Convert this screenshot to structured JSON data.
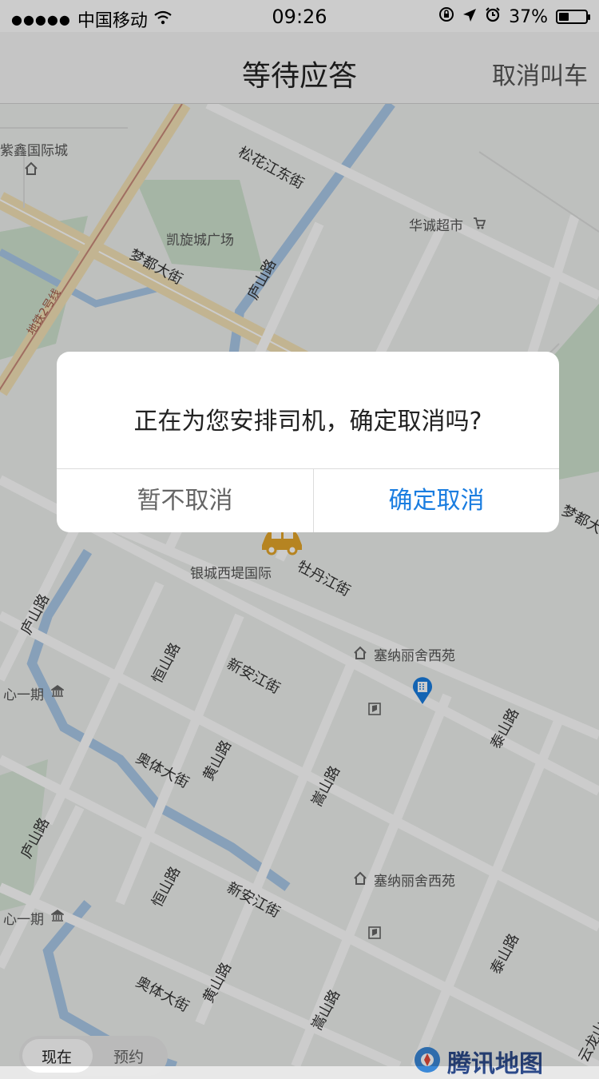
{
  "status_bar": {
    "carrier": "中国移动",
    "time": "09:26",
    "battery": "37%",
    "battery_level": 0.37
  },
  "nav": {
    "title": "等待应答",
    "cancel_label": "取消叫车"
  },
  "map": {
    "labels": {
      "zixin": "紫鑫国际城",
      "kaixuan": "凯旋城广场",
      "huacheng": "华诚超市",
      "yincheng": "银城西堤国际",
      "sainali_1": "塞纳丽舍西苑",
      "sainali_2": "塞纳丽舍西苑",
      "xinyiqi_1": "心一期",
      "xinyiqi_2": "心一期"
    },
    "roads": {
      "songhua": "松花江东街",
      "mengdu": "梦都大街",
      "mengdu_right": "梦都大",
      "lushan_top": "庐山路",
      "metro": "地铁2号线",
      "mudan": "牡丹江街",
      "lushan_left_1": "庐山路",
      "lushan_left_2": "庐山路",
      "hengshan_1": "恒山路",
      "hengshan_2": "恒山路",
      "xinan_1": "新安江街",
      "xinan_2": "新安江街",
      "aoti_1": "奥体大街",
      "aoti_2": "奥体大街",
      "huangshan_1": "黄山路",
      "huangshan_2": "黄山路",
      "songshan_1": "嵩山路",
      "songshan_2": "嵩山路",
      "taishan_1": "泰山路",
      "taishan_2": "泰山路",
      "yunlong": "云龙山"
    },
    "brand_text": "腾讯地图"
  },
  "dialog": {
    "message": "正在为您安排司机，确定取消吗?",
    "keep_label": "暂不取消",
    "confirm_label": "确定取消"
  },
  "tabs": {
    "now_label": "现在",
    "reserve_label": "预约"
  },
  "colors": {
    "confirm": "#1a7de0",
    "car": "#e4a62a",
    "water": "#a9c8e8",
    "green": "#cfe3cf"
  }
}
